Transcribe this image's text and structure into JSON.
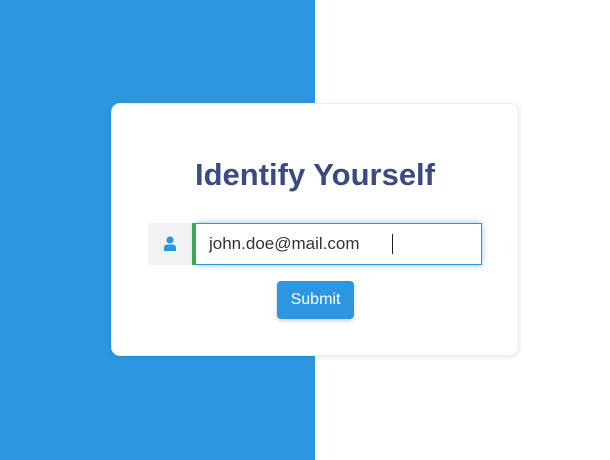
{
  "card": {
    "title": "Identify Yourself"
  },
  "email_field": {
    "value": "john.doe@mail.com",
    "icon": "user-icon"
  },
  "submit": {
    "label": "Submit"
  },
  "colors": {
    "primary": "#2d96e0",
    "title": "#3b4a80",
    "valid_accent": "#3aae3f",
    "background_right": "#ffffff"
  }
}
